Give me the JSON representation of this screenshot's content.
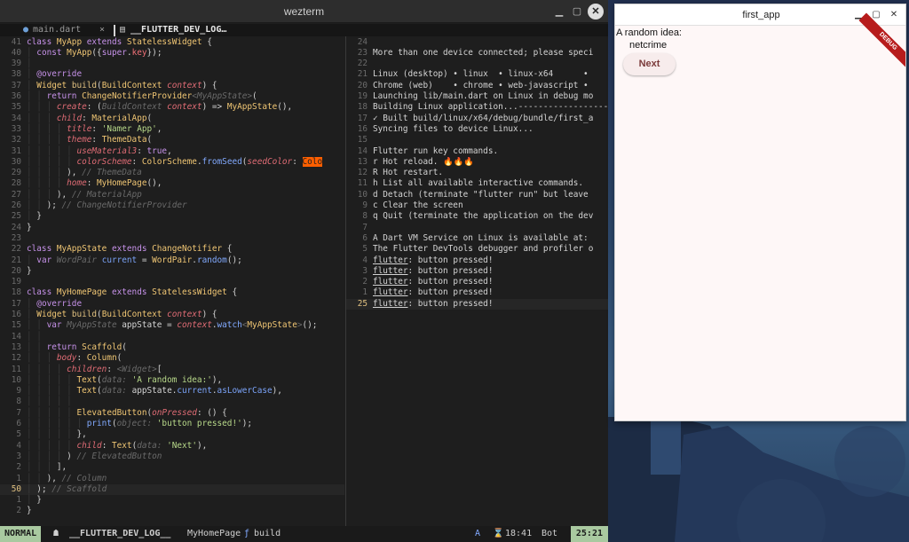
{
  "wezterm": {
    "title": "wezterm",
    "tab1": {
      "dot": "●",
      "name": "main.dart",
      "close": "×"
    },
    "tab2": {
      "icon": "▤",
      "name": "__FLUTTER_DEV_LOG…"
    }
  },
  "code_lines": [
    {
      "n": "41",
      "t": [
        [
          "kw",
          "class "
        ],
        [
          "ty",
          "MyApp "
        ],
        [
          "kw",
          "extends "
        ],
        [
          "ty",
          "StatelessWidget "
        ],
        [
          "",
          "{"
        ]
      ]
    },
    {
      "n": "40",
      "t": [
        [
          "gd",
          "│ "
        ],
        [
          "kw",
          "const "
        ],
        [
          "ty",
          "MyApp"
        ],
        [
          "",
          "({"
        ],
        [
          "kw",
          "super"
        ],
        [
          "",
          "."
        ],
        [
          "fld",
          "key"
        ],
        [
          "",
          "});"
        ]
      ]
    },
    {
      "n": "39",
      "t": [
        [
          "gd",
          "│"
        ]
      ]
    },
    {
      "n": "38",
      "t": [
        [
          "gd",
          "│ "
        ],
        [
          "at",
          "@override"
        ]
      ]
    },
    {
      "n": "37",
      "t": [
        [
          "gd",
          "│ "
        ],
        [
          "ty",
          "Widget "
        ],
        [
          "fn",
          "build"
        ],
        [
          "",
          "("
        ],
        [
          "ty",
          "BuildContext "
        ],
        [
          "pm",
          "context"
        ],
        [
          "",
          ") {"
        ]
      ]
    },
    {
      "n": "36",
      "t": [
        [
          "gd",
          "│ │ "
        ],
        [
          "kw",
          "return "
        ],
        [
          "ty",
          "ChangeNotifierProvider"
        ],
        [
          "cm",
          "<MyAppState>"
        ],
        [
          "",
          "("
        ]
      ]
    },
    {
      "n": "35",
      "t": [
        [
          "gd",
          "│ │ │ "
        ],
        [
          "pm",
          "create"
        ],
        [
          ":",
          ""
        ],
        [
          "",
          ": ("
        ],
        [
          "cm",
          "BuildContext "
        ],
        [
          "pm",
          "context"
        ],
        [
          "",
          ") => "
        ],
        [
          "ty",
          "MyAppState"
        ],
        [
          "",
          "(),"
        ]
      ]
    },
    {
      "n": "34",
      "t": [
        [
          "gd",
          "│ │ │ "
        ],
        [
          "pm",
          "child"
        ],
        [
          "",
          ": "
        ],
        [
          "ty",
          "MaterialApp"
        ],
        [
          "",
          "("
        ]
      ]
    },
    {
      "n": "33",
      "t": [
        [
          "gd",
          "│ │ │ │ "
        ],
        [
          "pm",
          "title"
        ],
        [
          "",
          ": "
        ],
        [
          "str",
          "'Namer App'"
        ],
        [
          "",
          ","
        ]
      ]
    },
    {
      "n": "32",
      "t": [
        [
          "gd",
          "│ │ │ │ "
        ],
        [
          "pm",
          "theme"
        ],
        [
          "",
          ": "
        ],
        [
          "ty",
          "ThemeData"
        ],
        [
          "",
          "("
        ]
      ]
    },
    {
      "n": "31",
      "t": [
        [
          "gd",
          "│ │ │ │ │ "
        ],
        [
          "pm",
          "useMaterial3"
        ],
        [
          "",
          ": "
        ],
        [
          "kw",
          "true"
        ],
        [
          "",
          ","
        ]
      ]
    },
    {
      "n": "30",
      "t": [
        [
          "gd",
          "│ │ │ │ │ "
        ],
        [
          "pm",
          "colorScheme"
        ],
        [
          "",
          ": "
        ],
        [
          "ty",
          "ColorScheme"
        ],
        [
          "",
          "."
        ],
        [
          "mb",
          "fromSeed"
        ],
        [
          "",
          "("
        ],
        [
          "pm",
          "seedColor"
        ],
        [
          "",
          ": "
        ],
        [
          "hl",
          "Colo"
        ]
      ]
    },
    {
      "n": "29",
      "t": [
        [
          "gd",
          "│ │ │ │ "
        ],
        [
          "",
          "), "
        ],
        [
          "cm",
          "// ThemeData"
        ]
      ]
    },
    {
      "n": "28",
      "t": [
        [
          "gd",
          "│ │ │ │ "
        ],
        [
          "pm",
          "home"
        ],
        [
          "",
          ": "
        ],
        [
          "ty",
          "MyHomePage"
        ],
        [
          "",
          "(),"
        ]
      ]
    },
    {
      "n": "27",
      "t": [
        [
          "gd",
          "│ │ │ "
        ],
        [
          "",
          "), "
        ],
        [
          "cm",
          "// MaterialApp"
        ]
      ]
    },
    {
      "n": "26",
      "t": [
        [
          "gd",
          "│ │ "
        ],
        [
          "",
          "); "
        ],
        [
          "cm",
          "// ChangeNotifierProvider"
        ]
      ]
    },
    {
      "n": "25",
      "t": [
        [
          "gd",
          "│ "
        ],
        [
          "",
          "}"
        ]
      ]
    },
    {
      "n": "24",
      "t": [
        [
          "",
          "}"
        ]
      ]
    },
    {
      "n": "23",
      "t": []
    },
    {
      "n": "22",
      "t": [
        [
          "kw",
          "class "
        ],
        [
          "ty",
          "MyAppState "
        ],
        [
          "kw",
          "extends "
        ],
        [
          "ty",
          "ChangeNotifier "
        ],
        [
          "",
          "{"
        ]
      ]
    },
    {
      "n": "21",
      "t": [
        [
          "gd",
          "│ "
        ],
        [
          "kw",
          "var "
        ],
        [
          "cm",
          "WordPair "
        ],
        [
          "vr",
          "current "
        ],
        [
          "",
          "= "
        ],
        [
          "ty",
          "WordPair"
        ],
        [
          "",
          "."
        ],
        [
          "mb",
          "random"
        ],
        [
          "",
          "();"
        ]
      ]
    },
    {
      "n": "20",
      "t": [
        [
          "",
          "}"
        ]
      ]
    },
    {
      "n": "19",
      "t": []
    },
    {
      "n": "18",
      "t": [
        [
          "kw",
          "class "
        ],
        [
          "ty",
          "MyHomePage "
        ],
        [
          "kw",
          "extends "
        ],
        [
          "ty",
          "StatelessWidget "
        ],
        [
          "",
          "{"
        ]
      ]
    },
    {
      "n": "17",
      "t": [
        [
          "gd",
          "│ "
        ],
        [
          "at",
          "@override"
        ]
      ]
    },
    {
      "n": "16",
      "t": [
        [
          "gd",
          "│ "
        ],
        [
          "ty",
          "Widget "
        ],
        [
          "fn",
          "build"
        ],
        [
          "",
          "("
        ],
        [
          "ty",
          "BuildContext "
        ],
        [
          "pm",
          "context"
        ],
        [
          "",
          ") {"
        ]
      ]
    },
    {
      "n": "15",
      "t": [
        [
          "gd",
          "│ │ "
        ],
        [
          "kw",
          "var "
        ],
        [
          "cm",
          "MyAppState "
        ],
        [
          "",
          "appState = "
        ],
        [
          "pm",
          "context"
        ],
        [
          "",
          "."
        ],
        [
          "mb",
          "watch"
        ],
        [
          "cm",
          "<"
        ],
        [
          "ty",
          "MyAppState"
        ],
        [
          "cm",
          ">"
        ],
        [
          "",
          "();"
        ]
      ]
    },
    {
      "n": "14",
      "t": [
        [
          "gd",
          "│ │"
        ]
      ]
    },
    {
      "n": "13",
      "t": [
        [
          "gd",
          "│ │ "
        ],
        [
          "kw",
          "return "
        ],
        [
          "ty",
          "Scaffold"
        ],
        [
          "",
          "("
        ]
      ]
    },
    {
      "n": "12",
      "t": [
        [
          "gd",
          "│ │ │ "
        ],
        [
          "pm",
          "body"
        ],
        [
          "",
          ": "
        ],
        [
          "ty",
          "Column"
        ],
        [
          "",
          "("
        ]
      ]
    },
    {
      "n": "11",
      "t": [
        [
          "gd",
          "│ │ │ │ "
        ],
        [
          "pm",
          "children"
        ],
        [
          "",
          ": "
        ],
        [
          "cm",
          "<Widget>"
        ],
        [
          "",
          "["
        ]
      ]
    },
    {
      "n": "10",
      "t": [
        [
          "gd",
          "│ │ │ │ │ "
        ],
        [
          "ty",
          "Text"
        ],
        [
          "",
          "("
        ],
        [
          "cm",
          "data: "
        ],
        [
          "str",
          "'A random idea:'"
        ],
        [
          "",
          "),"
        ]
      ]
    },
    {
      "n": "9",
      "t": [
        [
          "gd",
          "│ │ │ │ │ "
        ],
        [
          "ty",
          "Text"
        ],
        [
          "",
          "("
        ],
        [
          "cm",
          "data: "
        ],
        [
          "",
          "appState."
        ],
        [
          "vr",
          "current"
        ],
        [
          "",
          "."
        ],
        [
          "vr",
          "asLowerCase"
        ],
        [
          "",
          "),"
        ]
      ]
    },
    {
      "n": "8",
      "t": [
        [
          "gd",
          "│ │ │ │ │"
        ]
      ]
    },
    {
      "n": "7",
      "t": [
        [
          "gd",
          "│ │ │ │ │ "
        ],
        [
          "ty",
          "ElevatedButton"
        ],
        [
          "",
          "("
        ],
        [
          "pm",
          "onPressed"
        ],
        [
          "",
          ": () {"
        ]
      ]
    },
    {
      "n": "6",
      "t": [
        [
          "gd",
          "│ │ │ │ │ │ "
        ],
        [
          "mb",
          "print"
        ],
        [
          "",
          "("
        ],
        [
          "cm",
          "object: "
        ],
        [
          "str",
          "'button pressed!'"
        ],
        [
          "",
          ");"
        ]
      ]
    },
    {
      "n": "5",
      "t": [
        [
          "gd",
          "│ │ │ │ │ "
        ],
        [
          "",
          "},"
        ]
      ]
    },
    {
      "n": "4",
      "t": [
        [
          "gd",
          "│ │ │ │ │ "
        ],
        [
          "pm",
          "child"
        ],
        [
          "",
          ": "
        ],
        [
          "ty",
          "Text"
        ],
        [
          "",
          "("
        ],
        [
          "cm",
          "data: "
        ],
        [
          "str",
          "'Next'"
        ],
        [
          "",
          "),"
        ]
      ]
    },
    {
      "n": "3",
      "t": [
        [
          "gd",
          "│ │ │ │ "
        ],
        [
          "",
          ") "
        ],
        [
          "cm",
          "// ElevatedButton"
        ]
      ]
    },
    {
      "n": "2",
      "t": [
        [
          "gd",
          "│ │ │ "
        ],
        [
          "",
          "],"
        ]
      ]
    },
    {
      "n": "1",
      "t": [
        [
          "gd",
          "│ │ "
        ],
        [
          "",
          "), "
        ],
        [
          "cm",
          "// Column"
        ]
      ]
    },
    {
      "n": "50",
      "cur": true,
      "t": [
        [
          "gd",
          "│ "
        ],
        [
          "",
          "); "
        ],
        [
          "cm",
          "// Scaffold"
        ]
      ]
    },
    {
      "n": "1",
      "t": [
        [
          "gd",
          "│ "
        ],
        [
          "",
          "}"
        ]
      ]
    },
    {
      "n": "2",
      "t": [
        [
          "",
          "}"
        ]
      ]
    }
  ],
  "term_lines": [
    {
      "n": "24",
      "t": ""
    },
    {
      "n": "23",
      "t": "More than one device connected; please speci"
    },
    {
      "n": "22",
      "t": ""
    },
    {
      "n": "21",
      "t": "Linux (desktop) • linux  • linux-x64      •"
    },
    {
      "n": "20",
      "t": "Chrome (web)    • chrome • web-javascript •"
    },
    {
      "n": "19",
      "t": "Launching lib/main.dart on Linux in debug mo"
    },
    {
      "n": "18",
      "t": "Building Linux application..."
    },
    {
      "n": "17",
      "t": "✓ Built build/linux/x64/debug/bundle/first_a"
    },
    {
      "n": "16",
      "t": "Syncing files to device Linux..."
    },
    {
      "n": "15",
      "t": ""
    },
    {
      "n": "14",
      "t": "Flutter run key commands."
    },
    {
      "n": "13",
      "t": "r Hot reload. 🔥🔥🔥"
    },
    {
      "n": "12",
      "t": "R Hot restart."
    },
    {
      "n": "11",
      "t": "h List all available interactive commands."
    },
    {
      "n": "10",
      "t": "d Detach (terminate \"flutter run\" but leave"
    },
    {
      "n": "9",
      "t": "c Clear the screen"
    },
    {
      "n": "8",
      "t": "q Quit (terminate the application on the dev"
    },
    {
      "n": "7",
      "t": ""
    },
    {
      "n": "6",
      "t": "A Dart VM Service on Linux is available at:"
    },
    {
      "n": "5",
      "t": "The Flutter DevTools debugger and profiler o"
    },
    {
      "n": "4",
      "t": "flutter: button pressed!",
      "ul": true
    },
    {
      "n": "3",
      "t": "flutter: button pressed!",
      "ul": true
    },
    {
      "n": "2",
      "t": "flutter: button pressed!",
      "ul": true
    },
    {
      "n": "1",
      "t": "flutter: button pressed!",
      "ul": true
    },
    {
      "n": "25",
      "cur": true,
      "t": "flutter: button pressed!",
      "ul": true
    }
  ],
  "term_dash": "-----------------------",
  "statusbar": {
    "mode": "NORMAL",
    "icon": "☗",
    "file": "__FLUTTER_DEV_LOG__",
    "crumb_class": "MyHomePage",
    "crumb_sep": "ƒ",
    "crumb_fn": "build",
    "lsp": "A",
    "clock_icon": "⌛",
    "time": "18:41",
    "scroll": "Bot",
    "position": "25:21"
  },
  "flutter_app": {
    "title": "first_app",
    "debug_banner": "DEBUG",
    "idea_label": "A random idea:",
    "word": "netcrime",
    "next_button": "Next"
  },
  "window_controls": {
    "min": "▁",
    "max": "▢",
    "close": "✕"
  }
}
